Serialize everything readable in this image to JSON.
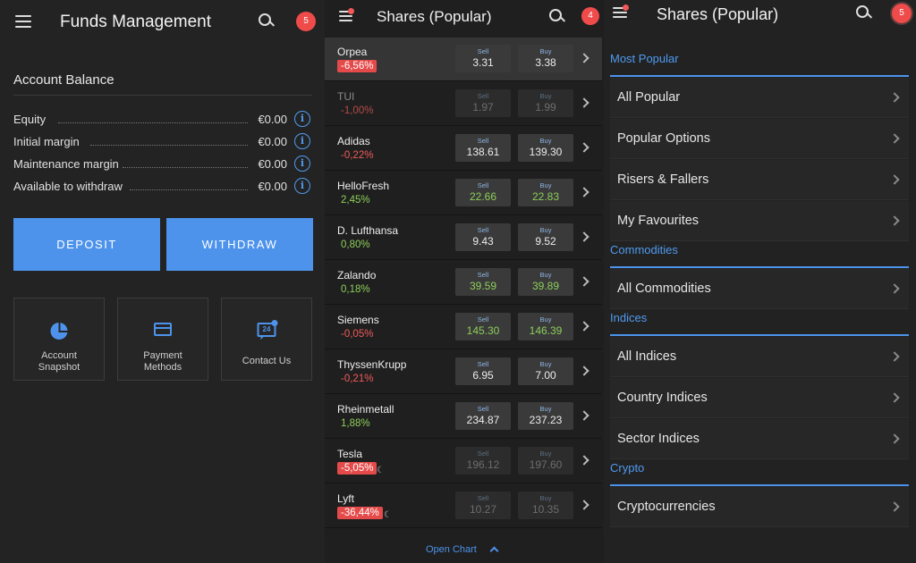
{
  "funds": {
    "title": "Funds Management",
    "badge": "5",
    "account_balance_title": "Account Balance",
    "rows": [
      {
        "label": "Equity",
        "amount": "€0.00"
      },
      {
        "label": "Initial margin",
        "amount": "€0.00"
      },
      {
        "label": "Maintenance margin",
        "amount": "€0.00"
      },
      {
        "label": "Available to withdraw",
        "amount": "€0.00"
      }
    ],
    "info_glyph": "i",
    "deposit_label": "DEPOSIT",
    "withdraw_label": "WITHDRAW",
    "cards": [
      {
        "label": "Account\nSnapshot",
        "icon": "pie-chart-icon"
      },
      {
        "label": "Payment\nMethods",
        "icon": "credit-card-icon"
      },
      {
        "label": "Contact Us",
        "icon": "chat-24-icon"
      }
    ],
    "contact_icon_text": "24",
    "accent": "#4d93ec"
  },
  "shares": {
    "title": "Shares (Popular)",
    "badge": "4",
    "sell_label": "Sell",
    "buy_label": "Buy",
    "items": [
      {
        "name": "Orpea",
        "change": "-6,56%",
        "dir": "negbg",
        "sell": "3.31",
        "buy": "3.38",
        "state": "sel"
      },
      {
        "name": "TUI",
        "change": "-1,00%",
        "dir": "neg",
        "sell": "1.97",
        "buy": "1.99",
        "state": "dim"
      },
      {
        "name": "Adidas",
        "change": "-0,22%",
        "dir": "neg",
        "sell": "138.61",
        "buy": "139.30",
        "state": ""
      },
      {
        "name": "HelloFresh",
        "change": "2,45%",
        "dir": "pos",
        "sell": "22.66",
        "buy": "22.83",
        "state": "green"
      },
      {
        "name": "D. Lufthansa",
        "change": "0,80%",
        "dir": "pos",
        "sell": "9.43",
        "buy": "9.52",
        "state": ""
      },
      {
        "name": "Zalando",
        "change": "0,18%",
        "dir": "pos",
        "sell": "39.59",
        "buy": "39.89",
        "state": "green"
      },
      {
        "name": "Siemens",
        "change": "-0,05%",
        "dir": "neg",
        "sell": "145.30",
        "buy": "146.39",
        "state": "green"
      },
      {
        "name": "ThyssenKrupp",
        "change": "-0,21%",
        "dir": "neg",
        "sell": "6.95",
        "buy": "7.00",
        "state": ""
      },
      {
        "name": "Rheinmetall",
        "change": "1,88%",
        "dir": "pos",
        "sell": "234.87",
        "buy": "237.23",
        "state": ""
      },
      {
        "name": "Tesla",
        "change": "-5,05%",
        "dir": "negbg",
        "sell": "196.12",
        "buy": "197.60",
        "state": "dimtile",
        "extra_icon": "moon-icon"
      },
      {
        "name": "Lyft",
        "change": "-36,44%",
        "dir": "negbg",
        "sell": "10.27",
        "buy": "10.35",
        "state": "dimtile",
        "extra_icon": "moon-icon"
      }
    ],
    "open_chart_label": "Open Chart",
    "negative_color": "#f05a5a",
    "positive_color": "#8ecf5a"
  },
  "markets": {
    "title": "Shares (Popular)",
    "badge": "5",
    "sections": [
      {
        "title": "Most Popular",
        "items": [
          "All Popular",
          "Popular Options",
          "Risers & Fallers",
          "My Favourites"
        ]
      },
      {
        "title": "Commodities",
        "items": [
          "All Commodities"
        ]
      },
      {
        "title": "Indices",
        "items": [
          "All Indices",
          "Country Indices",
          "Sector Indices"
        ]
      },
      {
        "title": "Crypto",
        "items": [
          "Cryptocurrencies"
        ]
      }
    ]
  }
}
